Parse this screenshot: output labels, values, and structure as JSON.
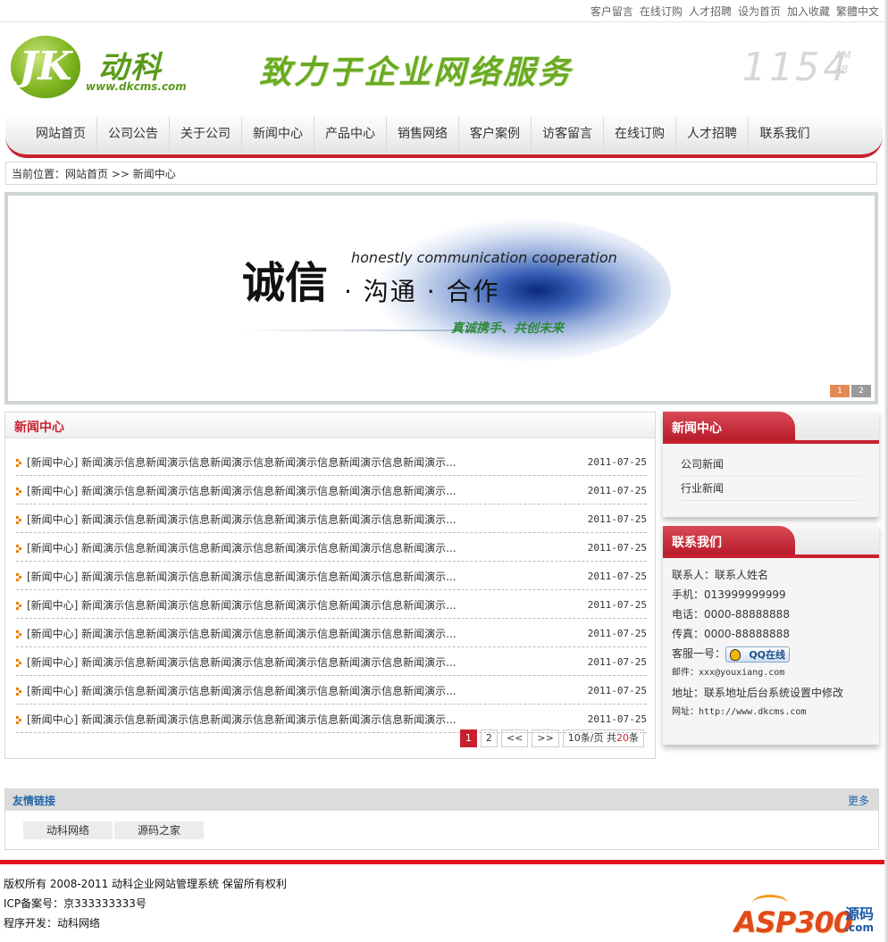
{
  "top_links": [
    "客户留言",
    "在线订购",
    "人才招聘",
    "设为首页",
    "加入收藏",
    "繁體中文"
  ],
  "logo": {
    "mark": "JK",
    "name": "动科",
    "url": "www.dkcms.com"
  },
  "slogan": "致力于企业网络服务",
  "clock": {
    "time": "1154",
    "ampm": "AM",
    "seconds": "48"
  },
  "nav": [
    "网站首页",
    "公司公告",
    "关于公司",
    "新闻中心",
    "产品中心",
    "销售网络",
    "客户案例",
    "访客留言",
    "在线订购",
    "人才招聘",
    "联系我们"
  ],
  "breadcrumb": "当前位置：网站首页 >> 新闻中心",
  "banner": {
    "big": "诚信",
    "english": "honestly communication cooperation",
    "middle": "· 沟通 · 合作",
    "green": "真诚携手、共创未来",
    "dots": [
      "1",
      "2"
    ]
  },
  "news": {
    "title": "新闻中心",
    "items": [
      {
        "title": "[新闻中心] 新闻演示信息新闻演示信息新闻演示信息新闻演示信息新闻演示信息新闻演示...",
        "date": "2011-07-25"
      },
      {
        "title": "[新闻中心] 新闻演示信息新闻演示信息新闻演示信息新闻演示信息新闻演示信息新闻演示...",
        "date": "2011-07-25"
      },
      {
        "title": "[新闻中心] 新闻演示信息新闻演示信息新闻演示信息新闻演示信息新闻演示信息新闻演示...",
        "date": "2011-07-25"
      },
      {
        "title": "[新闻中心] 新闻演示信息新闻演示信息新闻演示信息新闻演示信息新闻演示信息新闻演示...",
        "date": "2011-07-25"
      },
      {
        "title": "[新闻中心] 新闻演示信息新闻演示信息新闻演示信息新闻演示信息新闻演示信息新闻演示...",
        "date": "2011-07-25"
      },
      {
        "title": "[新闻中心] 新闻演示信息新闻演示信息新闻演示信息新闻演示信息新闻演示信息新闻演示...",
        "date": "2011-07-25"
      },
      {
        "title": "[新闻中心] 新闻演示信息新闻演示信息新闻演示信息新闻演示信息新闻演示信息新闻演示...",
        "date": "2011-07-25"
      },
      {
        "title": "[新闻中心] 新闻演示信息新闻演示信息新闻演示信息新闻演示信息新闻演示信息新闻演示...",
        "date": "2011-07-25"
      },
      {
        "title": "[新闻中心] 新闻演示信息新闻演示信息新闻演示信息新闻演示信息新闻演示信息新闻演示...",
        "date": "2011-07-25"
      },
      {
        "title": "[新闻中心] 新闻演示信息新闻演示信息新闻演示信息新闻演示信息新闻演示信息新闻演示...",
        "date": "2011-07-25"
      }
    ],
    "pagination": {
      "current": "1",
      "next_page": "2",
      "prev": "<<",
      "next": ">>",
      "per_page": "10条/页 共",
      "total": "20",
      "unit": "条"
    }
  },
  "sidebar_news": {
    "title": "新闻中心",
    "links": [
      "公司新闻",
      "行业新闻"
    ]
  },
  "contact": {
    "title": "联系我们",
    "person": "联系人：联系人姓名",
    "mobile": "手机：013999999999",
    "phone": "电话：0000-88888888",
    "fax": "传真：0000-88888888",
    "service_label": "客服一号：",
    "qq_label": "QQ在线",
    "email": "邮件：xxx@youxiang.com",
    "address": "地址：联系地址后台系统设置中修改",
    "website": "网址：http://www.dkcms.com"
  },
  "friend_links": {
    "title": "友情链接",
    "more": "更多",
    "links": [
      "动科网络",
      "源码之家"
    ]
  },
  "footer": {
    "copyright": "版权所有 2008-2011 动科企业网站管理系统 保留所有权利",
    "icp": "ICP备案号：京333333333号",
    "developer": "程序开发：动科网络"
  },
  "watermark": {
    "brand": "ASP300",
    "code": "源码",
    "com": ".com"
  },
  "colors": {
    "accent_red": "#c8202f",
    "logo_green": "#5a9a1a",
    "link_blue": "#2266aa",
    "bullet_orange": "#f07d00"
  }
}
